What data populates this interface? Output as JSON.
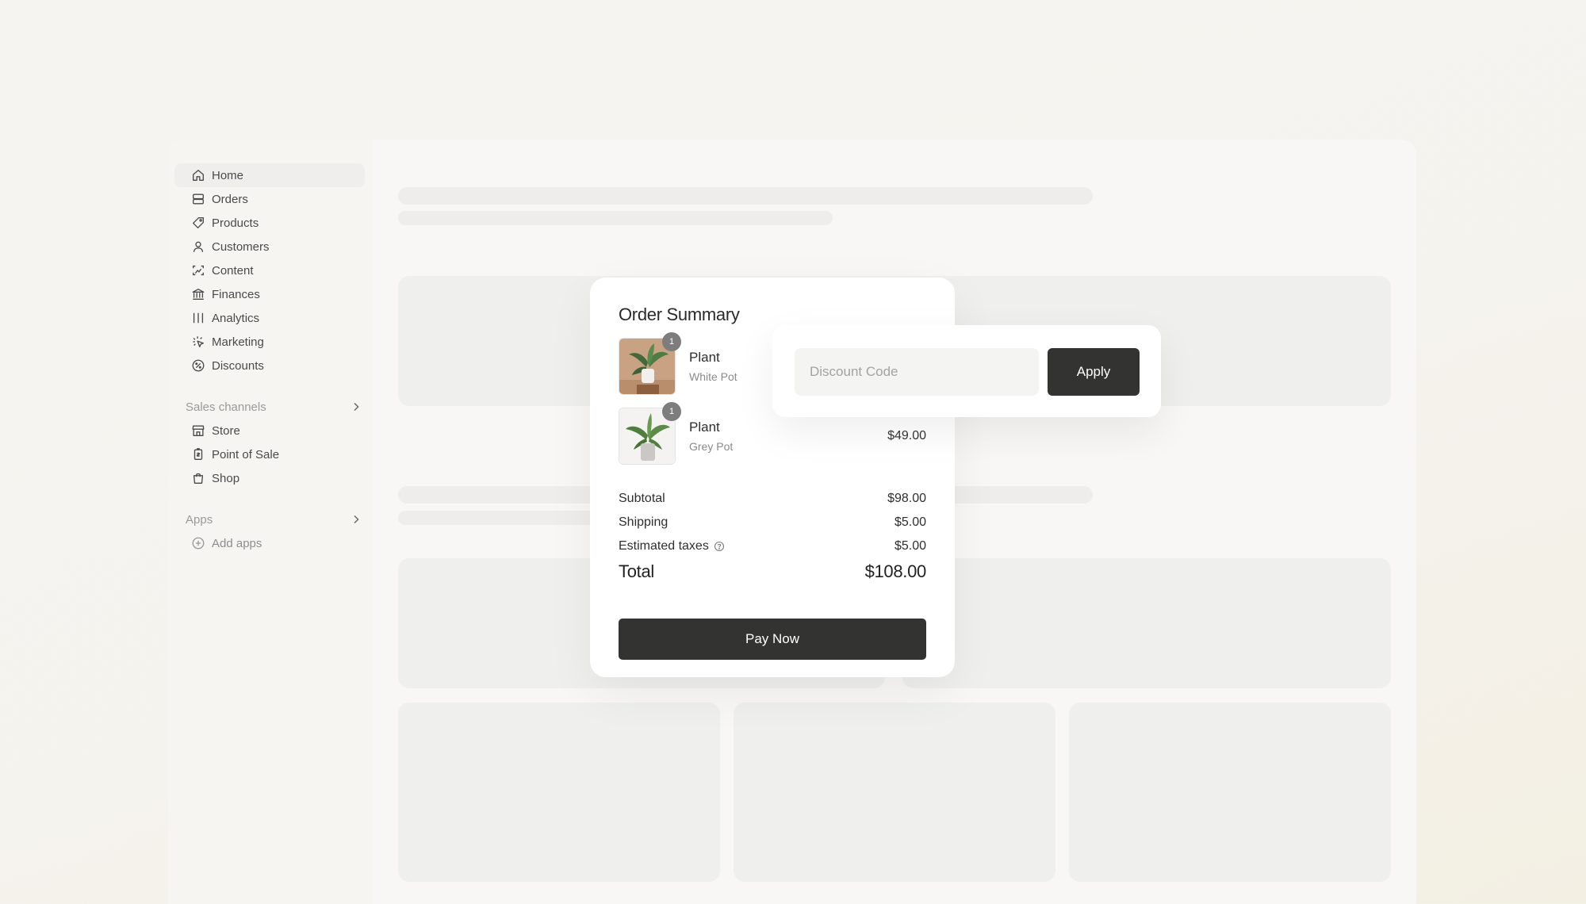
{
  "sidebar": {
    "items": [
      {
        "label": "Home",
        "icon": "home-icon"
      },
      {
        "label": "Orders",
        "icon": "orders-icon"
      },
      {
        "label": "Products",
        "icon": "tag-icon"
      },
      {
        "label": "Customers",
        "icon": "person-icon"
      },
      {
        "label": "Content",
        "icon": "content-icon"
      },
      {
        "label": "Finances",
        "icon": "bank-icon"
      },
      {
        "label": "Analytics",
        "icon": "analytics-icon"
      },
      {
        "label": "Marketing",
        "icon": "marketing-icon"
      },
      {
        "label": "Discounts",
        "icon": "discount-icon"
      }
    ],
    "sales_channels": {
      "title": "Sales channels",
      "items": [
        {
          "label": "Store",
          "icon": "store-icon"
        },
        {
          "label": "Point of Sale",
          "icon": "pos-icon"
        },
        {
          "label": "Shop",
          "icon": "shopping-bag-icon"
        }
      ]
    },
    "apps": {
      "title": "Apps",
      "add_label": "Add apps"
    }
  },
  "order_summary": {
    "title": "Order Summary",
    "items": [
      {
        "name": "Plant",
        "variant": "White Pot",
        "quantity": "1",
        "price": ""
      },
      {
        "name": "Plant",
        "variant": "Grey Pot",
        "quantity": "1",
        "price": "$49.00"
      }
    ],
    "subtotal_label": "Subtotal",
    "subtotal_value": "$98.00",
    "shipping_label": "Shipping",
    "shipping_value": "$5.00",
    "taxes_label": "Estimated taxes",
    "taxes_value": "$5.00",
    "total_label": "Total",
    "total_value": "$108.00",
    "pay_label": "Pay Now"
  },
  "discount": {
    "placeholder": "Discount Code",
    "apply_label": "Apply"
  },
  "colors": {
    "button_dark": "#333332",
    "background": "#f6f4f1"
  }
}
